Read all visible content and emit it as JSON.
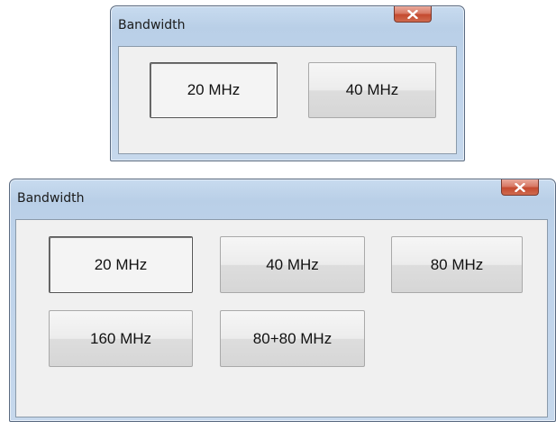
{
  "dialogs": [
    {
      "title": "Bandwidth",
      "close_glyph": "x",
      "buttons": [
        {
          "label": "20 MHz",
          "selected": true
        },
        {
          "label": "40 MHz",
          "selected": false
        }
      ]
    },
    {
      "title": "Bandwidth",
      "close_glyph": "x",
      "buttons": [
        {
          "label": "20 MHz",
          "selected": true
        },
        {
          "label": "40 MHz",
          "selected": false
        },
        {
          "label": "80 MHz",
          "selected": false
        },
        {
          "label": "160 MHz",
          "selected": false
        },
        {
          "label": "80+80 MHz",
          "selected": false
        }
      ]
    }
  ]
}
